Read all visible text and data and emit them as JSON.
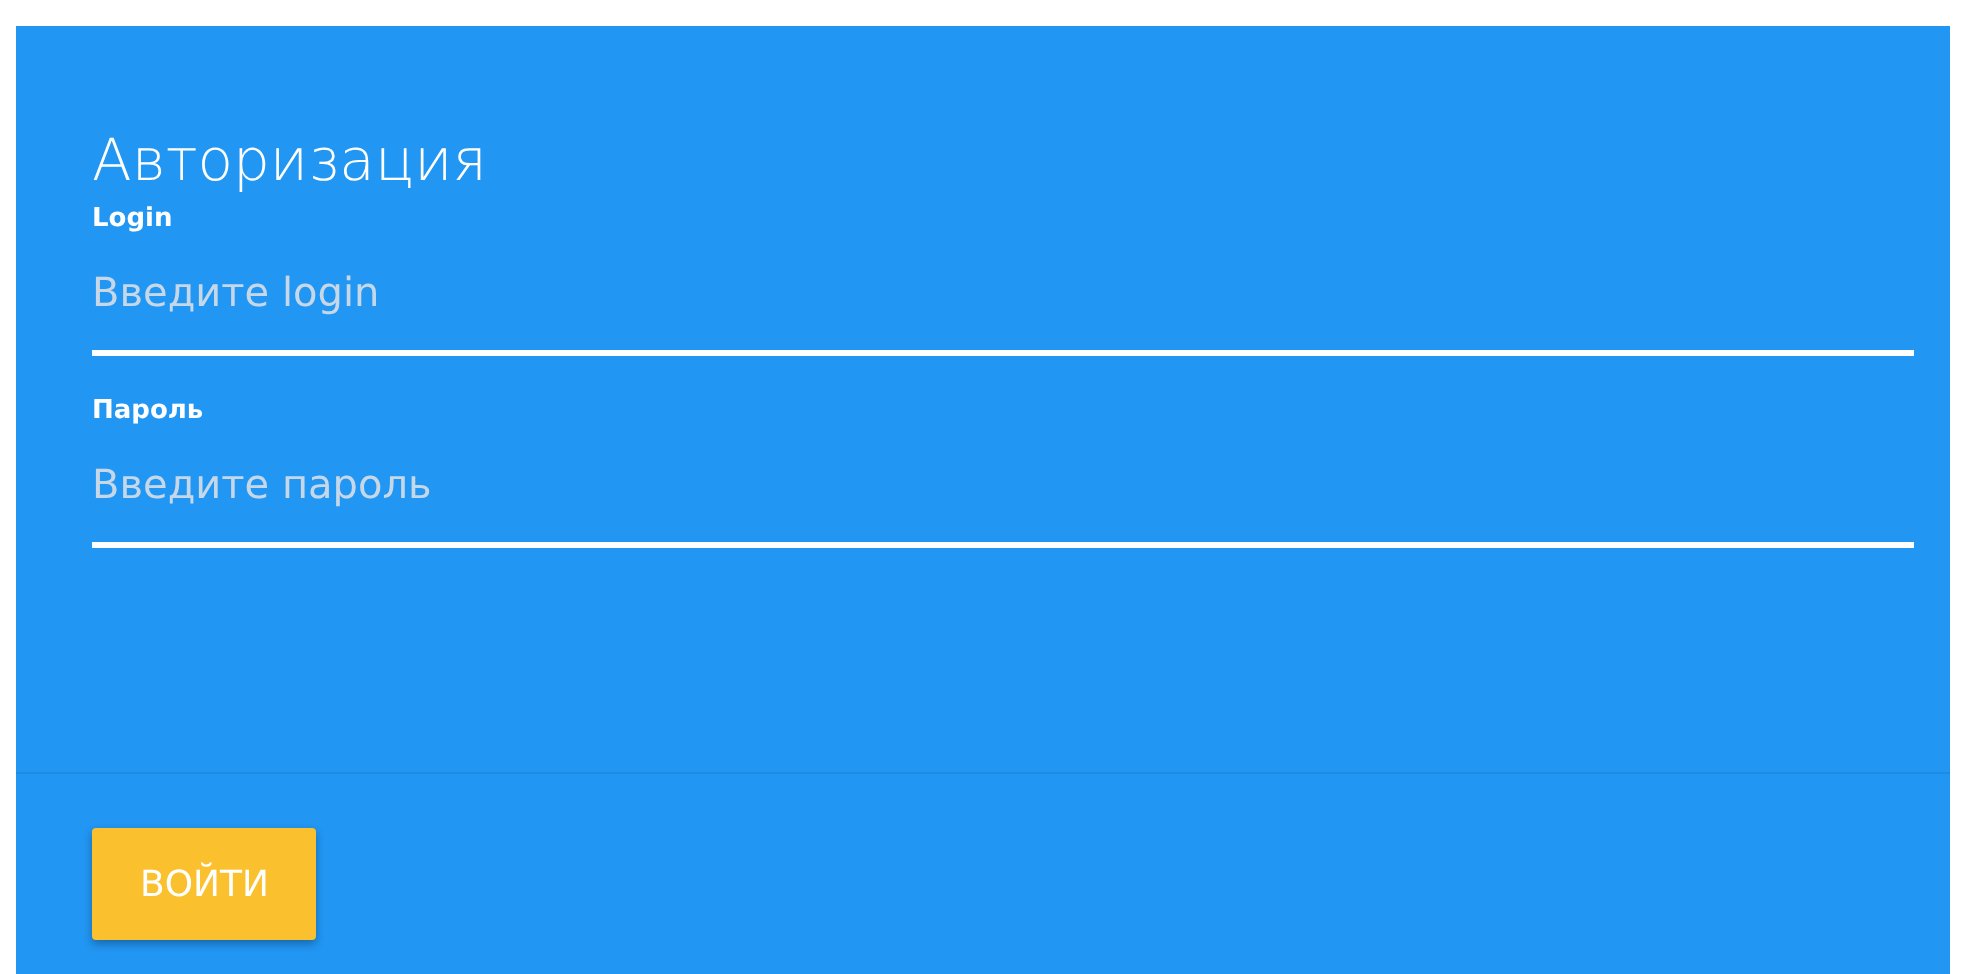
{
  "title": "Авторизация",
  "fields": [
    {
      "label": "Login",
      "placeholder": "Введите login"
    },
    {
      "label": "Пароль",
      "placeholder": "Введите пароль"
    }
  ],
  "submit_button": "ВОЙТИ"
}
